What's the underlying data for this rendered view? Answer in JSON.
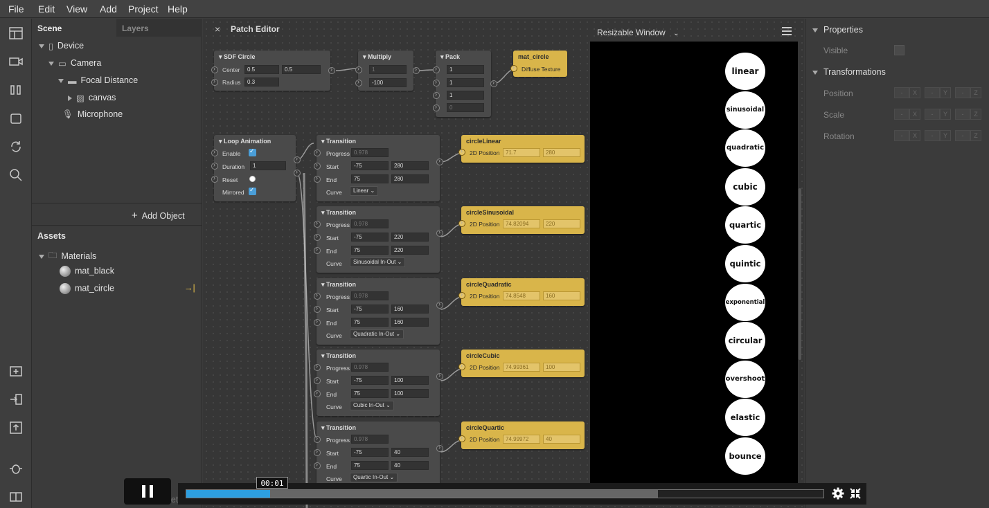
{
  "menu": [
    "File",
    "Edit",
    "View",
    "Add",
    "Project",
    "Help"
  ],
  "scene_tab": "Scene",
  "layers_tab": "Layers",
  "tree": {
    "device": "Device",
    "camera": "Camera",
    "focal": "Focal Distance",
    "canvas": "canvas",
    "microphone": "Microphone"
  },
  "add_object": "Add Object",
  "assets_title": "Assets",
  "materials": "Materials",
  "mat_black": "mat_black",
  "mat_circle": "mat_circle",
  "add_asset": "Add Asset",
  "patch_title": "Patch Editor",
  "resizable_window": "Resizable Window",
  "nodes": {
    "sdf": {
      "title": "SDF Circle",
      "center": "Center",
      "center_x": "0.5",
      "center_y": "0.5",
      "radius": "Radius",
      "radius_v": "0.3"
    },
    "multiply": {
      "title": "Multiply",
      "v1": "1",
      "v2": "-100"
    },
    "pack": {
      "title": "Pack",
      "v1": "1",
      "v2": "1",
      "v3": "1",
      "v4": "0"
    },
    "mat": {
      "title": "mat_circle",
      "port": "Diffuse Texture"
    },
    "loop": {
      "title": "Loop Animation",
      "enable": "Enable",
      "duration": "Duration",
      "duration_v": "1",
      "reset": "Reset",
      "mirrored": "Mirrored"
    }
  },
  "transitions": [
    {
      "title": "Transition",
      "progress": "0.978",
      "start": "-75",
      "start2": "280",
      "end": "75",
      "end2": "280",
      "curve": "Linear",
      "out_title": "circleLinear",
      "out_x": "71.7",
      "out_y": "280"
    },
    {
      "title": "Transition",
      "progress": "0.978",
      "start": "-75",
      "start2": "220",
      "end": "75",
      "end2": "220",
      "curve": "Sinusoidal In-Out",
      "out_title": "circleSinusoidal",
      "out_x": "74.82094",
      "out_y": "220"
    },
    {
      "title": "Transition",
      "progress": "0.978",
      "start": "-75",
      "start2": "160",
      "end": "75",
      "end2": "160",
      "curve": "Quadratic In-Out",
      "out_title": "circleQuadratic",
      "out_x": "74.8548",
      "out_y": "160"
    },
    {
      "title": "Transition",
      "progress": "0.978",
      "start": "-75",
      "start2": "100",
      "end": "75",
      "end2": "100",
      "curve": "Cubic In-Out",
      "out_title": "circleCubic",
      "out_x": "74.99361",
      "out_y": "100"
    },
    {
      "title": "Transition",
      "progress": "0.978",
      "start": "-75",
      "start2": "40",
      "end": "75",
      "end2": "40",
      "curve": "Quartic In-Out",
      "out_title": "circleQuartic",
      "out_x": "74.99972",
      "out_y": "40"
    }
  ],
  "labels": {
    "progress": "Progress",
    "start": "Start",
    "end": "End",
    "curve": "Curve",
    "pos2d": "2D Position"
  },
  "circles": [
    "linear",
    "sinusoidal",
    "quadratic",
    "cubic",
    "quartic",
    "quintic",
    "exponential",
    "circular",
    "overshoot",
    "elastic",
    "bounce"
  ],
  "props": {
    "properties": "Properties",
    "visible": "Visible",
    "transformations": "Transformations",
    "position": "Position",
    "scale": "Scale",
    "rotation": "Rotation",
    "x": "X",
    "y": "Y",
    "z": "Z"
  },
  "player": {
    "time": "00:01",
    "progress": 0.132,
    "buffered": 0.74
  }
}
